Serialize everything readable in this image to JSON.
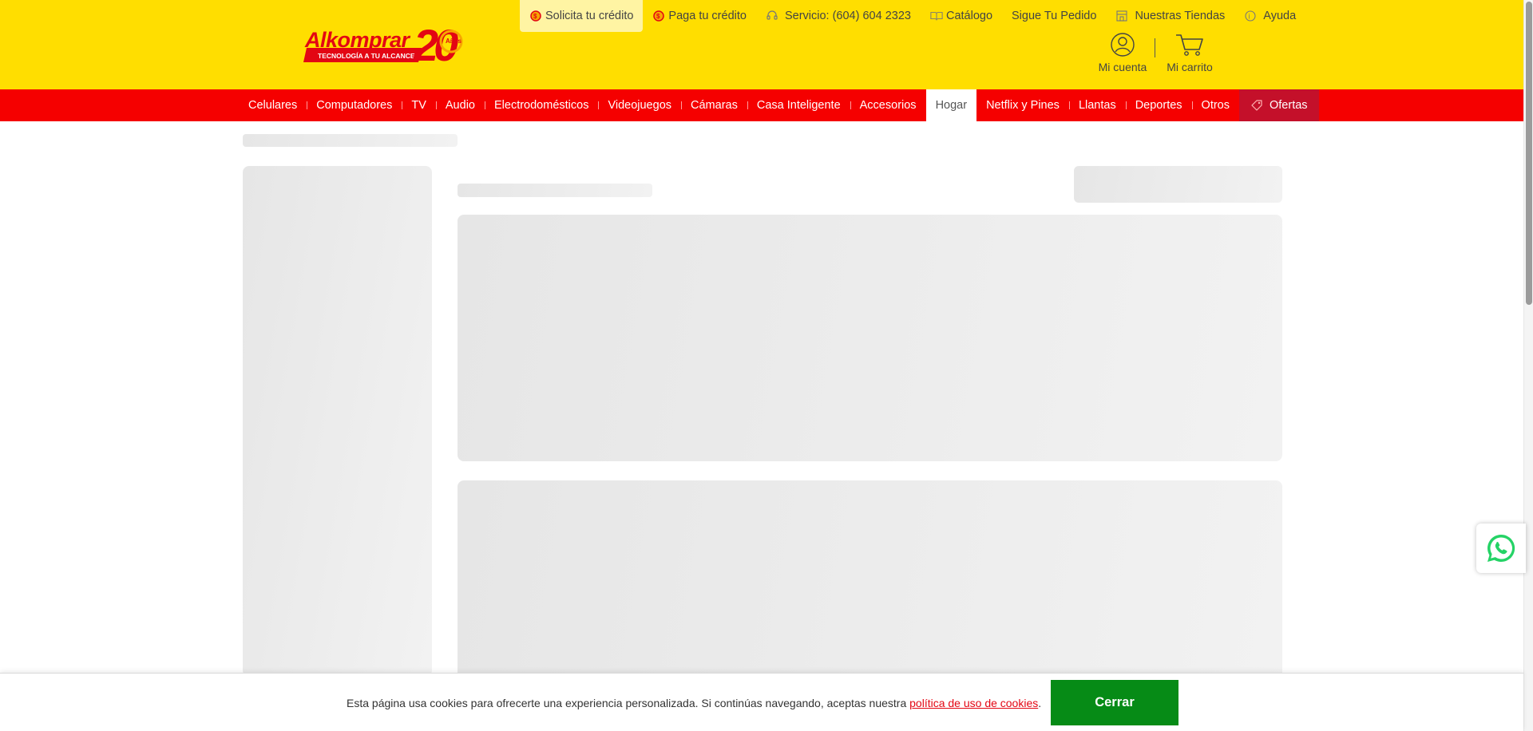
{
  "header": {
    "logo_text": "Alkomprar",
    "logo_tagline": "TECNOLOGÍA A TU ALCANCE",
    "logo_anniversary": "20",
    "logo_years": "Años",
    "utility_links": [
      {
        "label": "Solicita tu crédito",
        "icon": "credit-badge-icon"
      },
      {
        "label": "Paga tu crédito",
        "icon": "credit-badge-icon"
      },
      {
        "label": "Servicio: (604) 604 2323",
        "icon": "headset-icon"
      },
      {
        "label": "Catálogo",
        "icon": "book-icon"
      },
      {
        "label": "Sigue Tu Pedido",
        "icon": ""
      },
      {
        "label": "Nuestras Tiendas",
        "icon": "store-icon"
      },
      {
        "label": "Ayuda",
        "icon": "help-icon"
      }
    ],
    "account_label": "Mi cuenta",
    "cart_label": "Mi carrito"
  },
  "nav": {
    "items": [
      "Celulares",
      "Computadores",
      "TV",
      "Audio",
      "Electrodomésticos",
      "Videojuegos",
      "Cámaras",
      "Casa Inteligente",
      "Accesorios",
      "Hogar",
      "Netflix y Pines",
      "Llantas",
      "Deportes",
      "Otros"
    ],
    "active": "Hogar",
    "offers_label": "Ofertas"
  },
  "cookie_banner": {
    "text_before": "Esta página usa cookies para ofrecerte una experiencia personalizada. Si continúas navegando, aceptas nuestra ",
    "link_text": "política de uso de cookies",
    "text_after": ".",
    "button_label": "Cerrar"
  },
  "colors": {
    "header_bg": "#ffde00",
    "nav_bg": "#f50000",
    "offers_bg": "#c4102a",
    "cookie_button": "#068b16",
    "cookie_link": "#e30613",
    "whatsapp": "#25d366"
  }
}
